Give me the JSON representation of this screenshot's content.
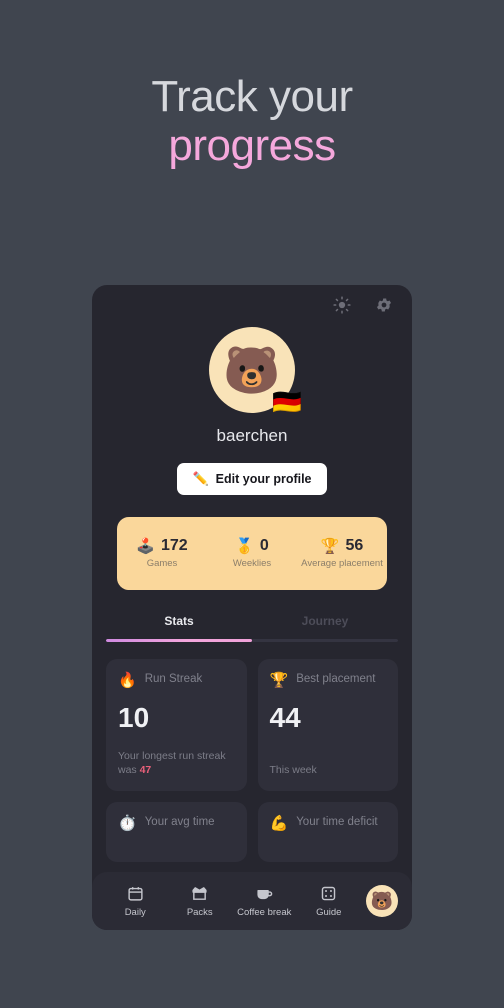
{
  "headline": {
    "line1": "Track your",
    "line2": "progress",
    "line1_color": "#d6d8dd",
    "line2_color": "#f5a8dc"
  },
  "phone": {
    "background": "#26262f",
    "topbar": {
      "theme_toggle_icon": "sun-icon",
      "settings_icon": "gear-icon"
    },
    "profile": {
      "avatar_emoji": "🐻",
      "flag_emoji": "🇩🇪",
      "username": "baerchen",
      "edit_button_label": "Edit your profile",
      "edit_button_icon": "✏️"
    },
    "summary_strip": {
      "background": "#fad79b",
      "cells": [
        {
          "icon": "🕹️",
          "value": "172",
          "label": "Games"
        },
        {
          "icon": "🥇",
          "value": "0",
          "label": "Weeklies"
        },
        {
          "icon": "🏆",
          "value": "56",
          "label": "Average placement"
        }
      ]
    },
    "tabs": [
      {
        "label": "Stats",
        "active": true
      },
      {
        "label": "Journey",
        "active": false
      }
    ],
    "stat_cards": [
      {
        "icon": "🔥",
        "title": "Run Streak",
        "value": "10",
        "footer_prefix": "Your longest run streak was ",
        "footer_highlight": "47"
      },
      {
        "icon": "🏆",
        "title": "Best placement",
        "value": "44",
        "footer_prefix": "This week",
        "footer_highlight": ""
      }
    ],
    "stat_cards_partial": [
      {
        "icon": "⏱️",
        "title": "Your avg time"
      },
      {
        "icon": "💪",
        "title": "Your time deficit"
      }
    ],
    "bottom_nav": {
      "items": [
        {
          "label": "Daily",
          "icon": "calendar-icon"
        },
        {
          "label": "Packs",
          "icon": "gift-box-icon"
        },
        {
          "label": "Coffee break",
          "icon": "coffee-cup-icon"
        },
        {
          "label": "Guide",
          "icon": "dice-icon"
        }
      ],
      "avatar_emoji": "🐻"
    }
  }
}
